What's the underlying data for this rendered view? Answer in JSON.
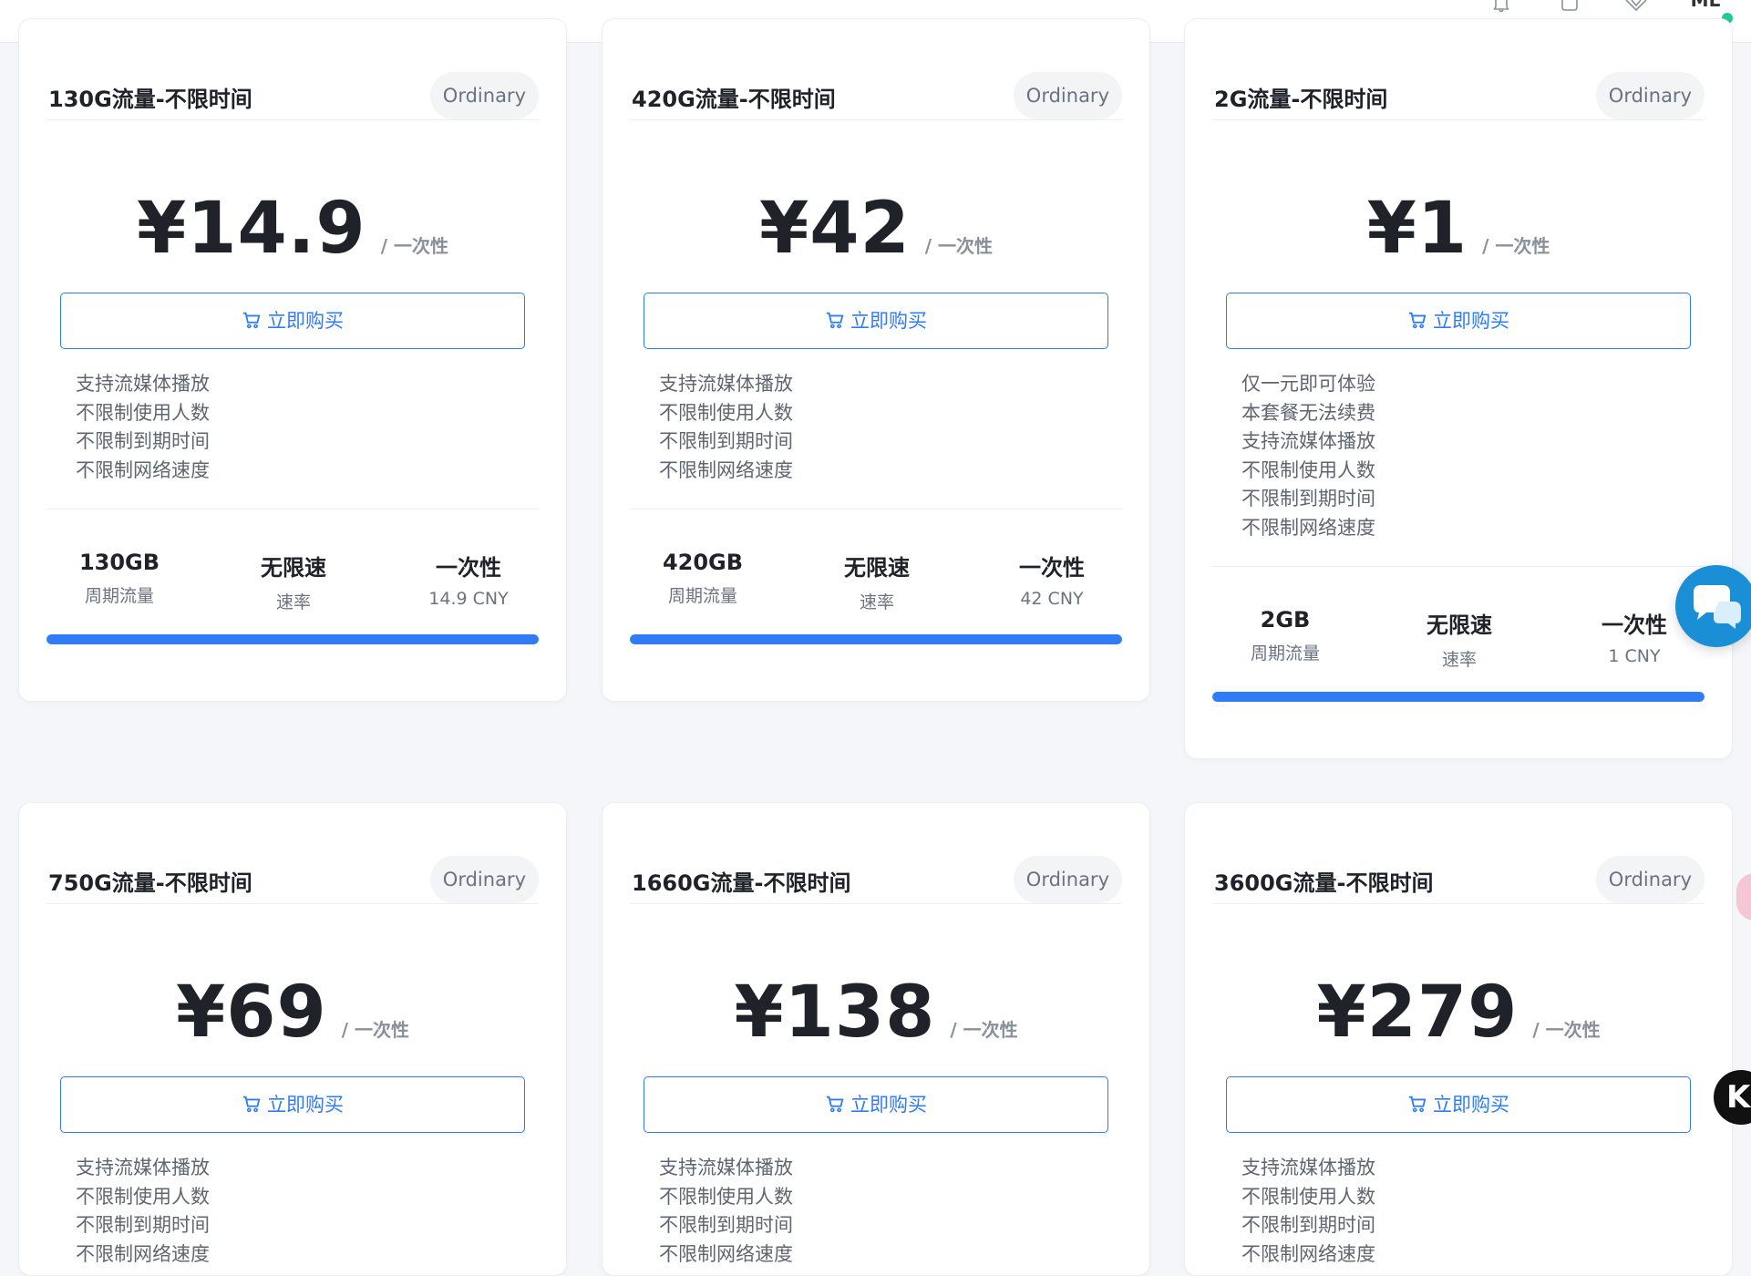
{
  "topbar": {
    "avatar_text": "ML",
    "icons": [
      "bell-icon",
      "chat-bubble-icon",
      "diamond-icon"
    ]
  },
  "colors": {
    "accent": "#2f7cf6",
    "online": "#20c997",
    "chat_fab": "#1a8fd6"
  },
  "plans": [
    {
      "title": "130G流量-不限时间",
      "badge": "Ordinary",
      "price": "¥14.9",
      "period": "/ 一次性",
      "buy_label": "立即购买",
      "features": [
        "支持流媒体播放",
        "不限制使用人数",
        "不限制到期时间",
        "不限制网络速度"
      ],
      "stats": [
        {
          "value": "130GB",
          "label": "周期流量"
        },
        {
          "value": "无限速",
          "label": "速率"
        },
        {
          "value": "一次性",
          "label": "14.9 CNY"
        }
      ],
      "progress": 1.0
    },
    {
      "title": "420G流量-不限时间",
      "badge": "Ordinary",
      "price": "¥42",
      "period": "/ 一次性",
      "buy_label": "立即购买",
      "features": [
        "支持流媒体播放",
        "不限制使用人数",
        "不限制到期时间",
        "不限制网络速度"
      ],
      "stats": [
        {
          "value": "420GB",
          "label": "周期流量"
        },
        {
          "value": "无限速",
          "label": "速率"
        },
        {
          "value": "一次性",
          "label": "42 CNY"
        }
      ],
      "progress": 1.0
    },
    {
      "title": "2G流量-不限时间",
      "badge": "Ordinary",
      "price": "¥1",
      "period": "/ 一次性",
      "buy_label": "立即购买",
      "features": [
        "仅一元即可体验",
        "本套餐无法续费",
        "支持流媒体播放",
        "不限制使用人数",
        "不限制到期时间",
        "不限制网络速度"
      ],
      "stats": [
        {
          "value": "2GB",
          "label": "周期流量"
        },
        {
          "value": "无限速",
          "label": "速率"
        },
        {
          "value": "一次性",
          "label": "1 CNY"
        }
      ],
      "progress": 1.0
    },
    {
      "title": "750G流量-不限时间",
      "badge": "Ordinary",
      "price": "¥69",
      "period": "/ 一次性",
      "buy_label": "立即购买",
      "features": [
        "支持流媒体播放",
        "不限制使用人数",
        "不限制到期时间",
        "不限制网络速度"
      ]
    },
    {
      "title": "1660G流量-不限时间",
      "badge": "Ordinary",
      "price": "¥138",
      "period": "/ 一次性",
      "buy_label": "立即购买",
      "features": [
        "支持流媒体播放",
        "不限制使用人数",
        "不限制到期时间",
        "不限制网络速度"
      ]
    },
    {
      "title": "3600G流量-不限时间",
      "badge": "Ordinary",
      "price": "¥279",
      "period": "/ 一次性",
      "buy_label": "立即购买",
      "features": [
        "支持流媒体播放",
        "不限制使用人数",
        "不限制到期时间",
        "不限制网络速度"
      ]
    }
  ],
  "floating": {
    "k_button_text": "K"
  }
}
